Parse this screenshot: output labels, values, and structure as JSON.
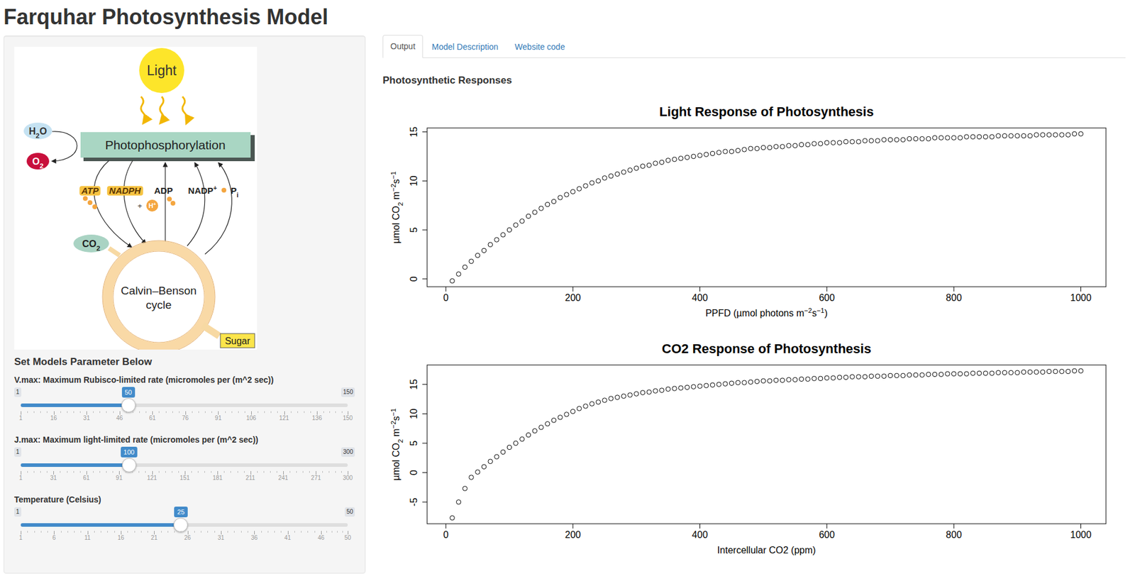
{
  "page": {
    "title": "Farquhar Photosynthesis Model"
  },
  "sidebar": {
    "diagram": {
      "light": "Light",
      "process": "Photophosphorylation",
      "water": [
        {
          "text": "H",
          "kind": "normal"
        },
        {
          "text": "2",
          "kind": "sub"
        },
        {
          "text": "O",
          "kind": "normal"
        }
      ],
      "oxygen": [
        {
          "text": "O",
          "kind": "normal"
        },
        {
          "text": "2",
          "kind": "sub"
        }
      ],
      "molecules": [
        {
          "parts": [
            {
              "text": "ATP",
              "kind": "normal"
            }
          ],
          "kind": "carrier"
        },
        {
          "parts": [
            {
              "text": "NADPH",
              "kind": "normal"
            }
          ],
          "kind": "carrier"
        },
        {
          "parts": [
            {
              "text": "ADP",
              "kind": "normal"
            }
          ],
          "kind": "plain"
        },
        {
          "parts": [
            {
              "text": "NADP",
              "kind": "normal"
            },
            {
              "text": "+",
              "kind": "sup"
            }
          ],
          "kind": "plain"
        },
        {
          "parts": [
            {
              "text": "P",
              "kind": "normal"
            },
            {
              "text": "i",
              "kind": "sub"
            }
          ],
          "kind": "plain"
        }
      ],
      "plus": "+",
      "proton": [
        {
          "text": "H",
          "kind": "normal"
        },
        {
          "text": "+",
          "kind": "sup"
        }
      ],
      "co2": [
        {
          "text": "CO",
          "kind": "normal"
        },
        {
          "text": "2",
          "kind": "sub"
        }
      ],
      "cycle": [
        "Calvin–Benson",
        "cycle"
      ],
      "product": "Sugar"
    },
    "heading": "Set Models Parameter Below",
    "sliders": [
      {
        "label": "V.max: Maximum Rubisco-limited rate (micromoles per (m^2 sec))",
        "min": "1",
        "max": "150",
        "value": "50",
        "level": 0.329,
        "ticks": [
          "1",
          "16",
          "31",
          "46",
          "61",
          "76",
          "91",
          "106",
          "121",
          "136",
          "150"
        ]
      },
      {
        "label": "J.max: Maximum light-limited rate (micromoles per (m^2 sec))",
        "min": "1",
        "max": "300",
        "value": "100",
        "level": 0.331,
        "ticks": [
          "1",
          "31",
          "61",
          "91",
          "121",
          "151",
          "181",
          "211",
          "241",
          "271",
          "300"
        ]
      },
      {
        "label": "Temperature (Celsius)",
        "min": "1",
        "max": "50",
        "value": "25",
        "level": 0.49,
        "ticks": [
          "1",
          "6",
          "11",
          "16",
          "21",
          "26",
          "31",
          "36",
          "41",
          "46",
          "50"
        ]
      }
    ]
  },
  "tabs": [
    {
      "label": "Output",
      "selected": true
    },
    {
      "label": "Model Description",
      "selected": false
    },
    {
      "label": "Website code",
      "selected": false
    }
  ],
  "section_title": "Photosynthetic Responses",
  "charts": [
    {
      "title": "Light Response of Photosynthesis",
      "x_label": [
        {
          "text": "PPFD (µmol photons m",
          "kind": "normal"
        },
        {
          "text": "−2",
          "kind": "sup"
        },
        {
          "text": "s",
          "kind": "normal"
        },
        {
          "text": "−1",
          "kind": "sup"
        },
        {
          "text": ")",
          "kind": "normal"
        }
      ],
      "y_label": [
        {
          "text": "µmol CO",
          "kind": "normal"
        },
        {
          "text": "2",
          "kind": "sub"
        },
        {
          "text": " m",
          "kind": "normal"
        },
        {
          "text": "−2",
          "kind": "sup"
        },
        {
          "text": "s",
          "kind": "normal"
        },
        {
          "text": "−1",
          "kind": "sup"
        }
      ],
      "x_ticks": [
        "0",
        "200",
        "400",
        "600",
        "800",
        "1000"
      ],
      "y_ticks": [
        "0",
        "5",
        "10",
        "15"
      ],
      "x": [
        10,
        20,
        30,
        40,
        50,
        60,
        70,
        80,
        90,
        100,
        110,
        120,
        130,
        140,
        150,
        160,
        170,
        180,
        190,
        200,
        210,
        220,
        230,
        240,
        250,
        260,
        270,
        280,
        290,
        300,
        310,
        320,
        330,
        340,
        350,
        360,
        370,
        380,
        390,
        400,
        410,
        420,
        430,
        440,
        450,
        460,
        470,
        480,
        490,
        500,
        510,
        520,
        530,
        540,
        550,
        560,
        570,
        580,
        590,
        600,
        610,
        620,
        630,
        640,
        650,
        660,
        670,
        680,
        690,
        700,
        710,
        720,
        730,
        740,
        750,
        760,
        770,
        780,
        790,
        800,
        810,
        820,
        830,
        840,
        850,
        860,
        870,
        880,
        890,
        900,
        910,
        920,
        930,
        940,
        950,
        960,
        970,
        980,
        990,
        1000
      ],
      "y": [
        -0.2,
        0.5,
        1.2,
        1.8,
        2.4,
        2.9,
        3.5,
        4.0,
        4.5,
        5.0,
        5.5,
        5.9,
        6.4,
        6.8,
        7.2,
        7.6,
        7.9,
        8.3,
        8.6,
        8.9,
        9.2,
        9.5,
        9.8,
        10.0,
        10.3,
        10.5,
        10.7,
        10.9,
        11.1,
        11.3,
        11.5,
        11.6,
        11.8,
        11.9,
        12.1,
        12.2,
        12.3,
        12.4,
        12.5,
        12.6,
        12.7,
        12.8,
        12.9,
        13.0,
        13.0,
        13.1,
        13.2,
        13.3,
        13.3,
        13.4,
        13.4,
        13.5,
        13.5,
        13.6,
        13.6,
        13.7,
        13.7,
        13.8,
        13.8,
        13.9,
        13.9,
        13.9,
        14.0,
        14.0,
        14.0,
        14.1,
        14.1,
        14.1,
        14.2,
        14.2,
        14.2,
        14.2,
        14.3,
        14.3,
        14.3,
        14.3,
        14.4,
        14.4,
        14.4,
        14.4,
        14.4,
        14.5,
        14.5,
        14.5,
        14.5,
        14.5,
        14.6,
        14.6,
        14.6,
        14.6,
        14.6,
        14.6,
        14.7,
        14.7,
        14.7,
        14.7,
        14.7,
        14.7,
        14.8,
        14.8
      ]
    },
    {
      "title": "CO2 Response of Photosynthesis",
      "x_label": [
        {
          "text": "Intercellular CO2 (ppm)",
          "kind": "normal"
        }
      ],
      "y_label": [
        {
          "text": "µmol CO",
          "kind": "normal"
        },
        {
          "text": "2",
          "kind": "sub"
        },
        {
          "text": " m",
          "kind": "normal"
        },
        {
          "text": "−2",
          "kind": "sup"
        },
        {
          "text": "s",
          "kind": "normal"
        },
        {
          "text": "−1",
          "kind": "sup"
        }
      ],
      "x_ticks": [
        "0",
        "200",
        "400",
        "600",
        "800",
        "1000"
      ],
      "y_ticks": [
        "-5",
        "0",
        "5",
        "10",
        "15"
      ],
      "x": [
        10,
        20,
        30,
        40,
        50,
        60,
        70,
        80,
        90,
        100,
        110,
        120,
        130,
        140,
        150,
        160,
        170,
        180,
        190,
        200,
        210,
        220,
        230,
        240,
        250,
        260,
        270,
        280,
        290,
        300,
        310,
        320,
        330,
        340,
        350,
        360,
        370,
        380,
        390,
        400,
        410,
        420,
        430,
        440,
        450,
        460,
        470,
        480,
        490,
        500,
        510,
        520,
        530,
        540,
        550,
        560,
        570,
        580,
        590,
        600,
        610,
        620,
        630,
        640,
        650,
        660,
        670,
        680,
        690,
        700,
        710,
        720,
        730,
        740,
        750,
        760,
        770,
        780,
        790,
        800,
        810,
        820,
        830,
        840,
        850,
        860,
        870,
        880,
        890,
        900,
        910,
        920,
        930,
        940,
        950,
        960,
        970,
        980,
        990,
        1000
      ],
      "y": [
        -7.7,
        -5.0,
        -2.7,
        -0.8,
        0.1,
        1.0,
        1.9,
        2.7,
        3.5,
        4.3,
        5.0,
        5.7,
        6.4,
        7.1,
        7.7,
        8.3,
        8.9,
        9.4,
        9.9,
        10.4,
        10.9,
        11.3,
        11.7,
        12.0,
        12.3,
        12.6,
        12.8,
        13.0,
        13.2,
        13.4,
        13.6,
        13.7,
        13.9,
        14.0,
        14.2,
        14.3,
        14.4,
        14.5,
        14.6,
        14.7,
        14.8,
        14.9,
        15.0,
        15.1,
        15.2,
        15.3,
        15.3,
        15.4,
        15.5,
        15.6,
        15.6,
        15.7,
        15.7,
        15.8,
        15.8,
        15.9,
        15.9,
        16.0,
        16.0,
        16.1,
        16.1,
        16.2,
        16.2,
        16.3,
        16.3,
        16.3,
        16.4,
        16.4,
        16.4,
        16.5,
        16.5,
        16.5,
        16.6,
        16.6,
        16.6,
        16.7,
        16.7,
        16.7,
        16.8,
        16.8,
        16.8,
        16.8,
        16.9,
        16.9,
        16.9,
        16.9,
        17.0,
        17.0,
        17.0,
        17.0,
        17.1,
        17.1,
        17.1,
        17.1,
        17.2,
        17.2,
        17.2,
        17.2,
        17.3,
        17.3
      ]
    }
  ]
}
